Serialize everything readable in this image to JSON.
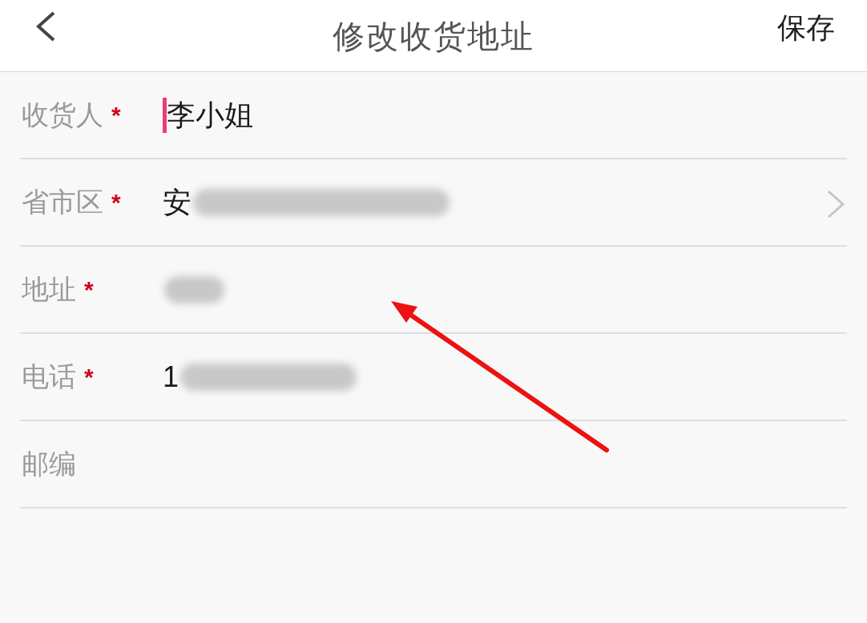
{
  "header": {
    "title": "修改收货地址",
    "action": "保存"
  },
  "fields": [
    {
      "label": "收货人",
      "required_mark": "*",
      "value": "李小姐",
      "focused": true,
      "redacted": false,
      "chevron": false
    },
    {
      "label": "省市区",
      "required_mark": "*",
      "value": "安",
      "focused": false,
      "redacted": true,
      "chevron": true
    },
    {
      "label": "地址",
      "required_mark": "*",
      "focused": false,
      "redacted": true,
      "chevron": false
    },
    {
      "label": "电话",
      "required_mark": "*",
      "value": "1",
      "focused": false,
      "redacted": true,
      "chevron": false
    },
    {
      "label": "邮编",
      "focused": false,
      "redacted": false,
      "chevron": false
    }
  ]
}
